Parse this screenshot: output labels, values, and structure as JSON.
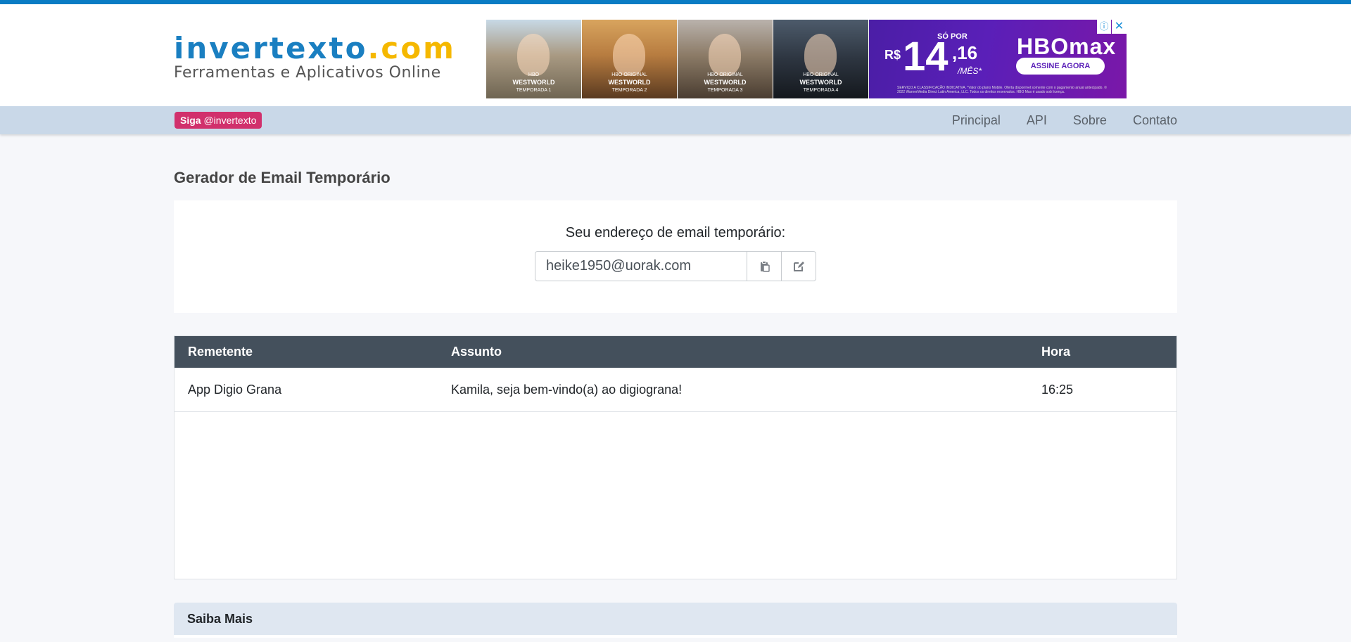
{
  "brand": {
    "name_main": "invertexto",
    "name_tld": ".com",
    "tagline": "Ferramentas e Aplicativos Online"
  },
  "ad": {
    "panels": [
      {
        "line1": "HBO",
        "line2": "WESTWORLD",
        "line3": "TEMPORADA 1"
      },
      {
        "line1": "HBO ORIGINAL",
        "line2": "WESTWORLD",
        "line3": "TEMPORADA 2"
      },
      {
        "line1": "HBO ORIGINAL",
        "line2": "WESTWORLD",
        "line3": "TEMPORADA 3"
      },
      {
        "line1": "HBO ORIGINAL",
        "line2": "WESTWORLD",
        "line3": "TEMPORADA 4"
      }
    ],
    "so_por": "SÓ POR",
    "currency": "R$",
    "price_int": "14",
    "price_dec": ",16",
    "per_month": "/MÊS*",
    "brand": "HBOmax",
    "cta": "ASSINE AGORA",
    "fine_print": "SERVIÇO A CLASSIFICAÇÃO INDICATIVA. *Valor do plano Mobile. Oferta disponível somente com o pagamento anual antecipado. © 2022 WarnerMedia Direct Latin America, LLC. Todos os direitos reservados. HBO Max é usado sob licença.",
    "adchoice_icon": "ⓘ",
    "close_icon": "✕"
  },
  "nav": {
    "follow_prefix": "Siga",
    "follow_handle": "@invertexto",
    "links": [
      "Principal",
      "API",
      "Sobre",
      "Contato"
    ]
  },
  "page": {
    "title": "Gerador de Email Temporário",
    "email_label": "Seu endereço de email temporário:",
    "email_value": "heike1950@uorak.com"
  },
  "inbox": {
    "columns": [
      "Remetente",
      "Assunto",
      "Hora"
    ],
    "rows": [
      {
        "from": "App Digio Grana",
        "subject": "Kamila, seja bem-vindo(a) ao digiograna!",
        "time": "16:25"
      }
    ]
  },
  "info": {
    "title": "Saiba Mais"
  },
  "colors": {
    "brand_blue": "#1a7fc1",
    "brand_yellow": "#f5b800",
    "follow_badge": "#d1306c",
    "navbar": "#c9d8e8",
    "table_header": "#44505c"
  }
}
